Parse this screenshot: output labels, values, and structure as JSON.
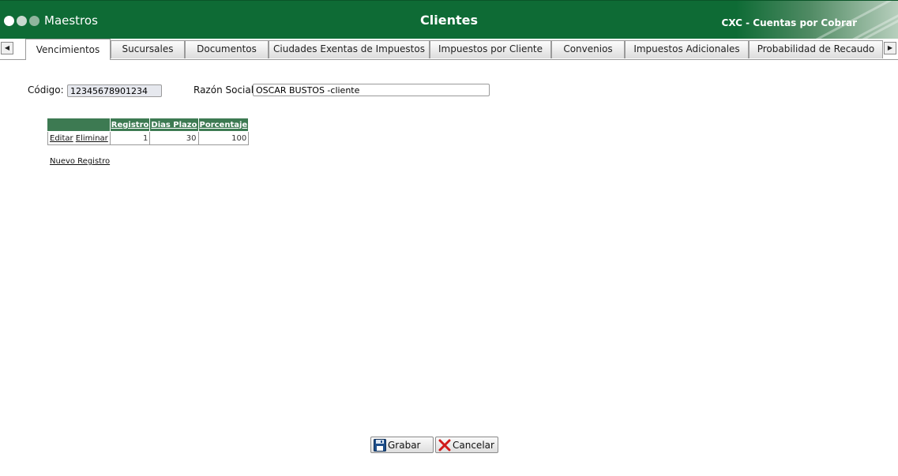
{
  "header": {
    "app_name": "Maestros",
    "page_title": "Clientes",
    "module_name": "CXC - Cuentas por Cobrar"
  },
  "tabs": [
    {
      "label": "Vencimientos",
      "active": true
    },
    {
      "label": "Sucursales"
    },
    {
      "label": "Documentos"
    },
    {
      "label": "Ciudades Exentas de Impuestos"
    },
    {
      "label": "Impuestos por Cliente"
    },
    {
      "label": "Convenios"
    },
    {
      "label": "Impuestos Adicionales"
    },
    {
      "label": "Probabilidad de Recaudo"
    }
  ],
  "form": {
    "codigo_label": "Código:",
    "codigo_value": "12345678901234",
    "razon_label": "Razón Social:",
    "razon_value": "OSCAR BUSTOS -cliente"
  },
  "grid": {
    "columns": [
      "Registro",
      "Dias Plazo",
      "Porcentaje"
    ],
    "rows": [
      {
        "edit": "Editar",
        "delete": "Eliminar",
        "registro": "1",
        "dias_plazo": "30",
        "porcentaje": "100"
      }
    ],
    "new_link": "Nuevo Registro"
  },
  "buttons": {
    "save": "Grabar",
    "cancel": "Cancelar"
  },
  "colors": {
    "header_green": "#0e6b35",
    "grid_header": "#3d7a52"
  },
  "icons": {
    "scroll_left": "triangle-left-icon",
    "scroll_right": "triangle-right-icon",
    "save": "floppy-disk-icon",
    "cancel": "red-x-icon"
  }
}
